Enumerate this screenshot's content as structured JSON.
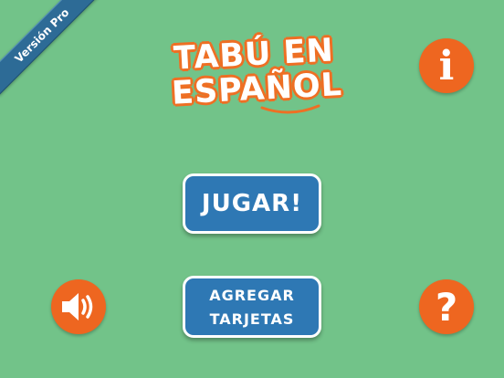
{
  "ribbon": {
    "label": "Versión Pro"
  },
  "logo": {
    "line1": "TABÚ EN",
    "line2": "ESPAÑOL"
  },
  "buttons": {
    "info_glyph": "i",
    "help_glyph": "?",
    "play_label": "JUGAR!",
    "add_cards_line1": "AGREGAR",
    "add_cards_line2": "TARJETAS"
  },
  "colors": {
    "background": "#72c389",
    "accent_orange": "#ee6620",
    "button_blue": "#2e78b4",
    "ribbon_blue": "#2d6b96"
  },
  "icons": {
    "info": "info-icon",
    "sound": "speaker-icon",
    "help": "question-icon"
  }
}
